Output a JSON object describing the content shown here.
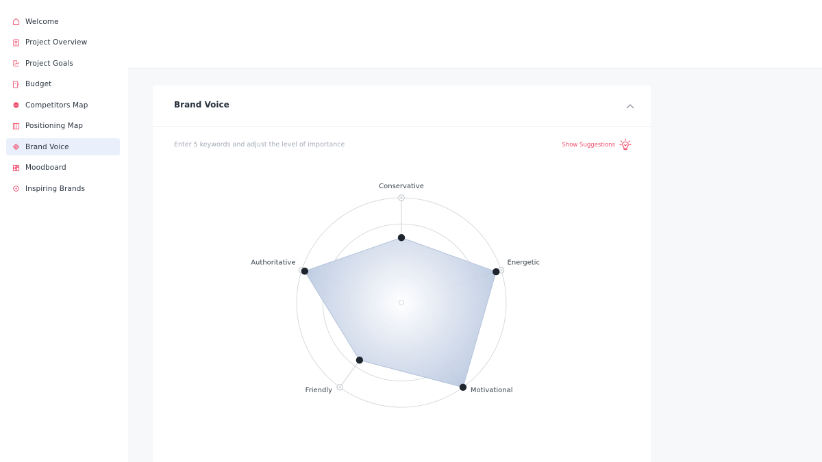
{
  "sidebar": {
    "items": [
      {
        "label": "Welcome",
        "icon": "home-icon",
        "active": false
      },
      {
        "label": "Project Overview",
        "icon": "document-icon",
        "active": false
      },
      {
        "label": "Project Goals",
        "icon": "goals-icon",
        "active": false
      },
      {
        "label": "Budget",
        "icon": "budget-icon",
        "active": false
      },
      {
        "label": "Competitors Map",
        "icon": "competitors-icon",
        "active": false
      },
      {
        "label": "Positioning Map",
        "icon": "positioning-icon",
        "active": false
      },
      {
        "label": "Brand Voice",
        "icon": "brand-voice-icon",
        "active": true
      },
      {
        "label": "Moodboard",
        "icon": "moodboard-icon",
        "active": false
      },
      {
        "label": "Inspiring Brands",
        "icon": "inspiring-icon",
        "active": false
      }
    ]
  },
  "card": {
    "title": "Brand Voice",
    "hint": "Enter 5 keywords and adjust the level of importance",
    "suggestions_label": "Show Suggestions"
  },
  "colors": {
    "accent": "#ef4f6e",
    "active_bg": "#e9f0fc",
    "fill": "#b9c7df",
    "point": "#1f252c"
  },
  "chart_data": {
    "type": "radar",
    "axes": [
      "Conservative",
      "Energetic",
      "Motivational",
      "Friendly",
      "Authoritative"
    ],
    "values": [
      0.62,
      0.95,
      1.0,
      0.68,
      0.97
    ],
    "max": 1,
    "rings": 4
  }
}
